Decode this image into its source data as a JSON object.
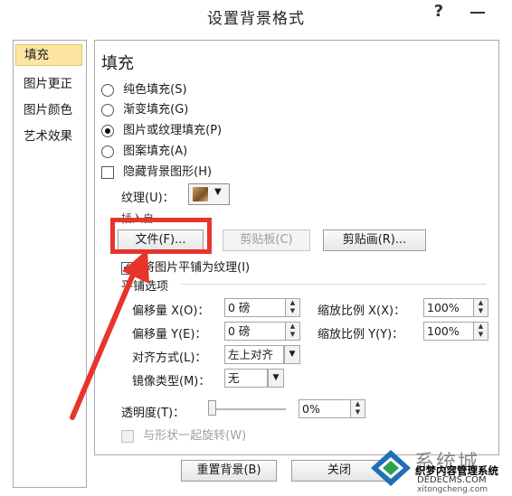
{
  "window": {
    "title": "设置背景格式",
    "help_label": "?",
    "close_label": "━"
  },
  "nav": {
    "items": [
      {
        "label": "填充",
        "selected": true
      },
      {
        "label": "图片更正",
        "selected": false
      },
      {
        "label": "图片颜色",
        "selected": false
      },
      {
        "label": "艺术效果",
        "selected": false
      }
    ]
  },
  "fill": {
    "section_title": "填充",
    "options": [
      {
        "label": "纯色填充(S)",
        "selected": false
      },
      {
        "label": "渐变填充(G)",
        "selected": false
      },
      {
        "label": "图片或纹理填充(P)",
        "selected": true
      },
      {
        "label": "图案填充(A)",
        "selected": false
      }
    ],
    "hide_bg_label": "隐藏背景图形(H)",
    "hide_bg_checked": false,
    "texture_label": "纹理(U)：",
    "insert_from_label": "插入自",
    "file_button": "文件(F)...",
    "clipboard_button": "剪贴板(C)",
    "clipart_button": "剪贴画(R)...",
    "tile_label": "将图片平铺为纹理(I)",
    "tile_checked": true,
    "tiling_options_label": "平铺选项",
    "offset_x_label": "偏移量 X(O)：",
    "offset_x_value": "0 磅",
    "scale_x_label": "缩放比例 X(X)：",
    "scale_x_value": "100%",
    "offset_y_label": "偏移量 Y(E)：",
    "offset_y_value": "0 磅",
    "scale_y_label": "缩放比例 Y(Y)：",
    "scale_y_value": "100%",
    "alignment_label": "对齐方式(L)：",
    "alignment_value": "左上对齐",
    "mirror_label": "镜像类型(M)：",
    "mirror_value": "无",
    "transparency_label": "透明度(T)：",
    "transparency_value": "0%",
    "rotate_label": "与形状一起旋转(W)",
    "rotate_checked": false
  },
  "footer": {
    "reset_button": "重置背景(B)",
    "close_button": "关闭"
  },
  "watermark": {
    "line1": "系统城",
    "line2": "织梦内容管理系统",
    "line3": "DEDECMS.COM",
    "line4": "xitongcheng.com"
  },
  "colors": {
    "nav_selected_bg": "#fce5a2",
    "highlight_box": "#e8342c",
    "arrow": "#e8342c"
  }
}
